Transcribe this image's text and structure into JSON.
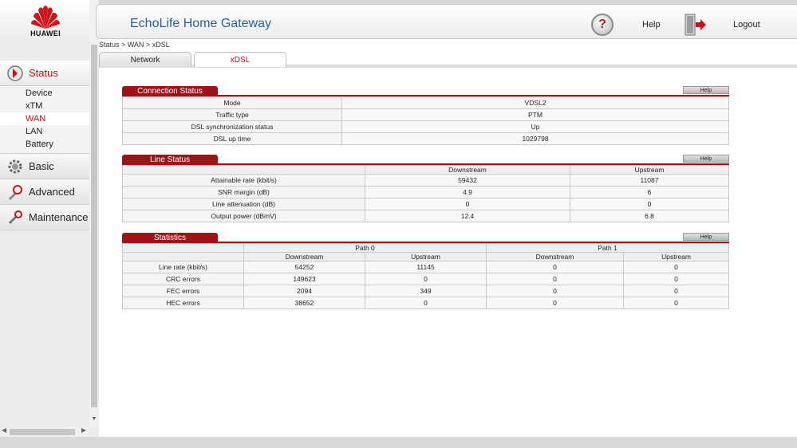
{
  "brand": {
    "name": "HUAWEI",
    "brand_color": "#d0121b"
  },
  "header": {
    "title": "EchoLife Home Gateway",
    "help_label": "Help",
    "logout_label": "Logout"
  },
  "breadcrumb": "Status > WAN > xDSL",
  "tabs": [
    {
      "label": "Network",
      "active": false
    },
    {
      "label": "xDSL",
      "active": true
    }
  ],
  "sidebar": {
    "sections": [
      {
        "label": "Status",
        "icon": "status-icon",
        "active": true,
        "items": [
          {
            "label": "Device",
            "active": false
          },
          {
            "label": "xTM",
            "active": false
          },
          {
            "label": "WAN",
            "active": true
          },
          {
            "label": "LAN",
            "active": false
          },
          {
            "label": "Battery",
            "active": false
          }
        ]
      },
      {
        "label": "Basic",
        "icon": "gear-icon",
        "active": false
      },
      {
        "label": "Advanced",
        "icon": "advanced-icon",
        "active": false
      },
      {
        "label": "Maintenance",
        "icon": "maintenance-icon",
        "active": false
      }
    ]
  },
  "help_button_label": "Help",
  "connection_status": {
    "title": "Connection Status",
    "rows": [
      {
        "label": "Mode",
        "value": "VDSL2"
      },
      {
        "label": "Traffic type",
        "value": "PTM"
      },
      {
        "label": "DSL synchronization status",
        "value": "Up"
      },
      {
        "label": "DSL up time",
        "value": "1029798"
      }
    ]
  },
  "line_status": {
    "title": "Line Status",
    "columns": [
      "Downstream",
      "Upstream"
    ],
    "rows": [
      {
        "label": "Attainable rate (kbit/s)",
        "down": "59432",
        "up": "11087"
      },
      {
        "label": "SNR margin (dB)",
        "down": "4.9",
        "up": "6"
      },
      {
        "label": "Line attenuation (dB)",
        "down": "0",
        "up": "0"
      },
      {
        "label": "Output power (dBmV)",
        "down": "12.4",
        "up": "6.8"
      }
    ]
  },
  "statistics": {
    "title": "Statistics",
    "paths": [
      "Path 0",
      "Path 1"
    ],
    "columns": [
      "Downstream",
      "Upstream",
      "Downstream",
      "Upstream"
    ],
    "rows": [
      {
        "label": "Line rate (kbit/s)",
        "values": [
          "54252",
          "11145",
          "0",
          "0"
        ]
      },
      {
        "label": "CRC errors",
        "values": [
          "149623",
          "0",
          "0",
          "0"
        ]
      },
      {
        "label": "FEC errors",
        "values": [
          "2094",
          "349",
          "0",
          "0"
        ]
      },
      {
        "label": "HEC errors",
        "values": [
          "38652",
          "0",
          "0",
          "0"
        ]
      }
    ]
  }
}
